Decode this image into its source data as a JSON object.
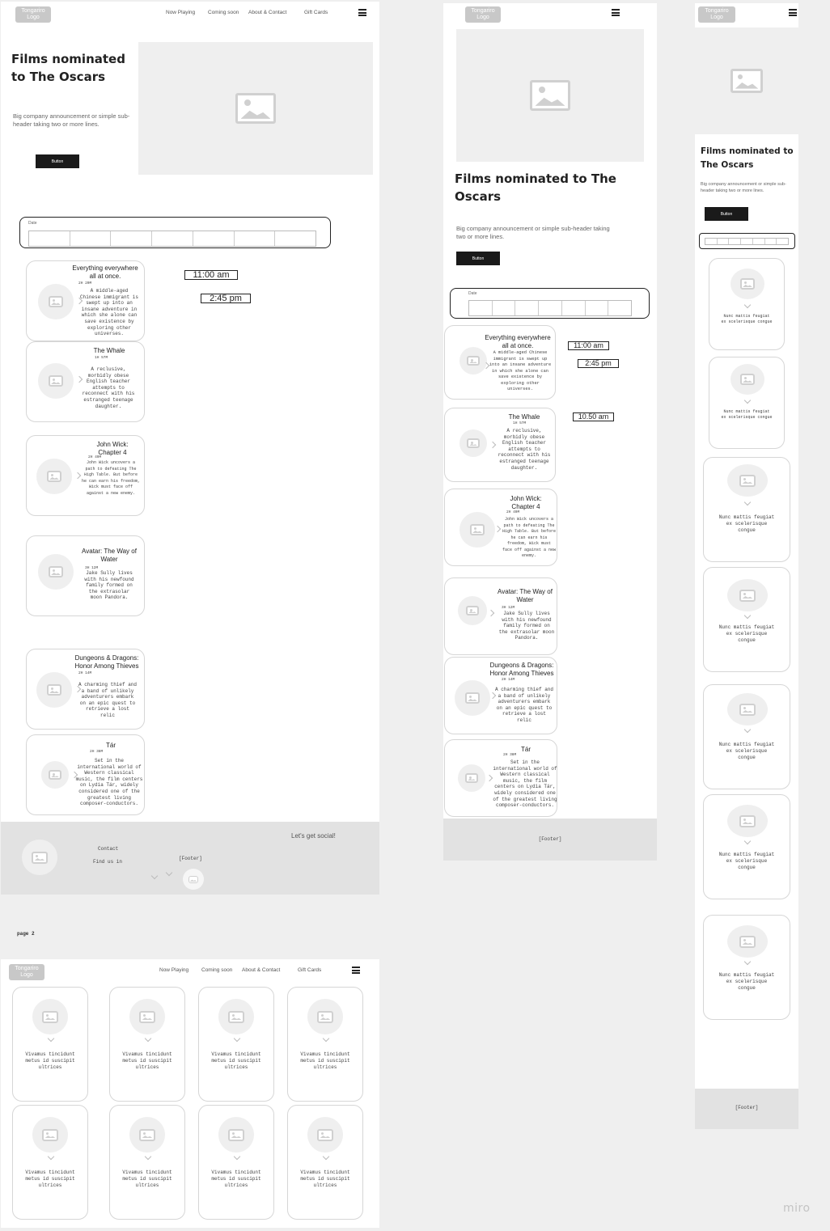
{
  "header": {
    "logo": "Tongariro Logo",
    "nav": [
      "Now Playing",
      "Coming soon",
      "About & Contact",
      "Gift Cards"
    ]
  },
  "hero": {
    "title": "Films nominated to The Oscars",
    "subtitle": "Big company announcement or simple sub-header taking two or more lines.",
    "button": "Button"
  },
  "date_label": "Date",
  "times": {
    "desktop": [
      "11:00 am",
      "2:45 pm"
    ],
    "tablet": [
      "11:00 am",
      "2:45 pm",
      "10.50 am"
    ]
  },
  "films": [
    {
      "title": "Everything everywhere all at once.",
      "duration": "2H 20M",
      "desc": "A middle-aged Chinese immigrant is swept up into an insane adventure in which she alone can save existence by exploring other universes."
    },
    {
      "title": "The Whale",
      "duration": "1H 57M",
      "desc": "A reclusive, morbidly obese English teacher attempts to reconnect with his estranged teenage daughter."
    },
    {
      "title": "John Wick: Chapter 4",
      "duration": "2H 49M",
      "desc": "John Wick uncovers a path to defeating The High Table. But before he can earn his freedom, Wick must face off against a new enemy."
    },
    {
      "title": "Avatar: The Way of Water",
      "duration": "3H 12M",
      "desc": "Jake Sully lives with his newfound family formed on the extrasolar moon Pandora."
    },
    {
      "title": "Dungeons & Dragons: Honor Among Thieves",
      "duration": "2H 14M",
      "desc": "A charming thief and a band of unlikely adventurers embark on an epic quest to retrieve a lost relic"
    },
    {
      "title": "Tár",
      "duration": "2H 38M",
      "desc": "Set in the international world of Western classical music, the film centers on Lydia Tár, widely considered one of the greatest living composer-conductors."
    }
  ],
  "footer": {
    "social": "Let's get social!",
    "contact": "Contact",
    "find": "Find us in",
    "placeholder": "[Footer]"
  },
  "page2_label": "page 2",
  "grid_card_text": "Vivamus tincidunt metus id suscipit ultrices",
  "mobile_card_text": "Nunc mattis feugiat ex scelerisque congue",
  "watermark": "miro"
}
